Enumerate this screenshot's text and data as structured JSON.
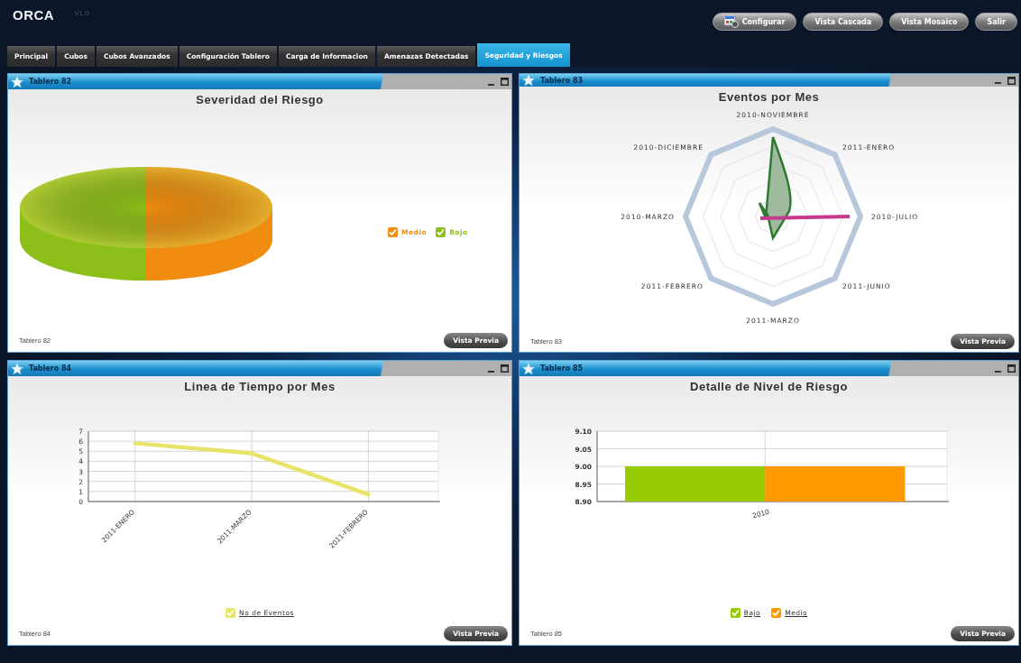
{
  "header": {
    "logo": "ORCA",
    "version": "V1.0",
    "buttons": [
      {
        "label": "Configurar",
        "kind": "icon"
      },
      {
        "label": "Vista Cascada",
        "kind": "plain"
      },
      {
        "label": "Vista Mosaico",
        "kind": "plain"
      },
      {
        "label": "Salir",
        "kind": "plain"
      }
    ]
  },
  "tabs": [
    {
      "label": "Principal",
      "selected": false
    },
    {
      "label": "Cubos",
      "selected": false
    },
    {
      "label": "Cubos Avanzados",
      "selected": false
    },
    {
      "label": "Configuración Tablero",
      "selected": false
    },
    {
      "label": "Carga de Informacion",
      "selected": false
    },
    {
      "label": "Amenazas Detectadas",
      "selected": false
    },
    {
      "label": "Seguridad y Riesgos",
      "selected": true
    }
  ],
  "panels": [
    {
      "title": "Tablero 82",
      "kind": "pie",
      "chart_title": "Severidad del Riesgo",
      "legend": [
        {
          "label": "Medio",
          "color": "#f08c10",
          "checked": true
        },
        {
          "label": "Bajo",
          "color": "#8cbf1a",
          "checked": true
        }
      ],
      "footer": "Tablero 82",
      "button": "Vista Previa"
    },
    {
      "title": "Tablero 83",
      "kind": "radar",
      "chart_title": "Eventos por Mes",
      "axes": [
        "2010-NOVIEMBRE",
        "2010-DICIEMBRE",
        "2011-ENERO",
        "2010-MARZO",
        "2010-JULIO",
        "2011-FEBRERO",
        "2011-JUNIO",
        "2011-MARZO"
      ],
      "footer": "Tablero 83",
      "button": "Vista Previa"
    },
    {
      "title": "Tablero 84",
      "kind": "chart",
      "chart_title": "Linea de Tiempo por Mes",
      "chart_data": {
        "type": "line",
        "categories": [
          "2011-ENERO",
          "2011-MARZO",
          "2011-FEBRERO"
        ],
        "series": [
          {
            "name": "No de Eventos",
            "color": "#e8e468",
            "values": [
              5.8,
              4.8,
              0.7
            ]
          }
        ],
        "ylim": [
          0,
          7
        ],
        "yticks": [
          0,
          1,
          2,
          3,
          4,
          5,
          6,
          7
        ],
        "grid": true
      },
      "legend": [
        {
          "checked": true
        }
      ],
      "footer": "Tablero 84",
      "button": "Vista Previa"
    },
    {
      "title": "Tablero 85",
      "kind": "chart",
      "chart_title": "Detalle de Nivel de Riesgo",
      "chart_data": {
        "type": "bar",
        "categories": [
          "2010"
        ],
        "series": [
          {
            "name": "Bajo",
            "color": "#99cc00",
            "values": [
              9.0
            ]
          },
          {
            "name": "Medio",
            "color": "#ff9900",
            "values": [
              9.0
            ]
          }
        ],
        "ylim": [
          8.9,
          9.1
        ],
        "yticks": [
          {
            "value": 8.9,
            "label": "8.90"
          },
          {
            "value": 8.95,
            "label": "8.95"
          },
          {
            "value": 9.0,
            "label": "9.00"
          },
          {
            "value": 9.05,
            "label": "9.05"
          },
          {
            "value": 9.1,
            "label": "9.10"
          }
        ],
        "grid": true
      },
      "legend": [
        {
          "checked": true
        },
        {
          "checked": true
        }
      ],
      "footer": "Tablero 85",
      "button": "Vista Previa"
    }
  ]
}
